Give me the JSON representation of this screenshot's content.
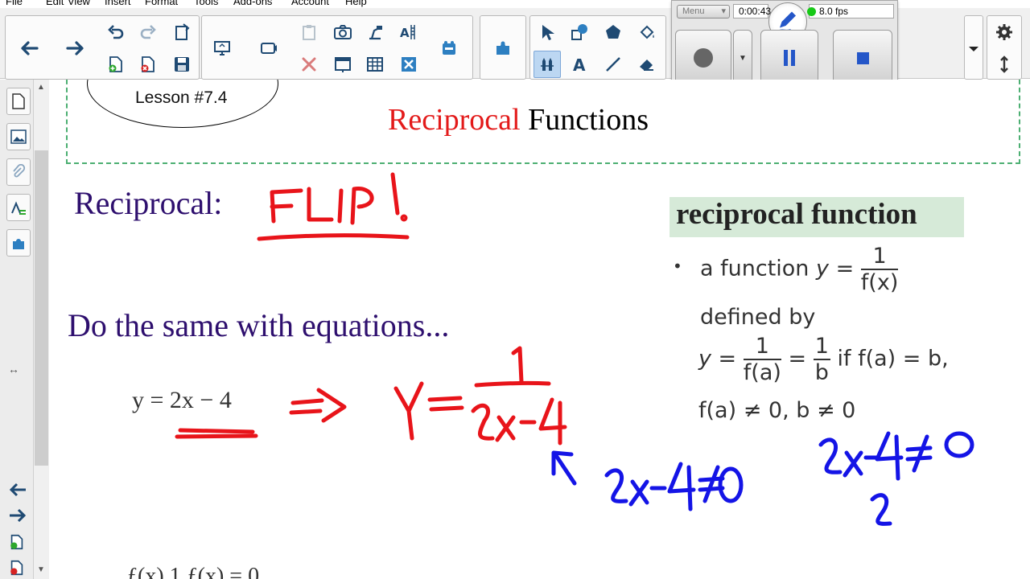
{
  "menu": [
    "File",
    "Edit",
    "View",
    "Insert",
    "Format",
    "Tools",
    "Add-ons",
    "Account",
    "Help"
  ],
  "recorder": {
    "menu_label": "Menu",
    "time": "0:00:43",
    "fps": "8.0 fps"
  },
  "lesson": {
    "label": "Lesson #7.4"
  },
  "title": {
    "part1": "Reciprocal",
    "part2": " Functions"
  },
  "content": {
    "reciprocal_label": "Reciprocal:",
    "do_same": "Do the same with equations...",
    "equation": "y = 2x − 4",
    "bottom_partial": "…  ƒ(x)         1         ƒ(x) = 0"
  },
  "definition": {
    "title": "reciprocal function",
    "bullet": "•",
    "line1_prefix": "a function ",
    "line1_y": "y = ",
    "line1_num": "1",
    "line1_den": "f(x)",
    "line2": "defined by",
    "line3_y": "y = ",
    "line3_num1": "1",
    "line3_den1": "f(a)",
    "line3_eq": " = ",
    "line3_num2": "1",
    "line3_den2": "b",
    "line3_suffix": " if f(a) = b,",
    "line4": "f(a) ≠ 0, b ≠ 0"
  },
  "colors": {
    "title_red": "#e31a1a",
    "heading_purple": "#2e0f6e",
    "ink_red": "#e8141a",
    "ink_blue": "#1414e6",
    "definition_bg": "#d6ead8",
    "dashed_border": "#4caf72"
  },
  "icons": {
    "toolbar": [
      "arrow-left-icon",
      "arrow-right-icon",
      "undo-icon",
      "redo-icon",
      "paste-icon",
      "new-page-icon",
      "delete-page-icon",
      "save-icon",
      "screen-share-icon",
      "screen-capture-icon",
      "clipboard-icon",
      "camera-icon",
      "document-camera-icon",
      "delete-icon",
      "screen-shade-icon",
      "table-icon",
      "math-tools-icon",
      "clear-icon",
      "addon-puzzle-icon",
      "select-icon",
      "shapes-icon",
      "fill-icon",
      "pens-icon",
      "text-icon",
      "line-icon",
      "eraser-icon"
    ],
    "sidebar": [
      "page-sorter-icon",
      "gallery-icon",
      "attachments-icon",
      "properties-icon",
      "addons-icon"
    ]
  }
}
